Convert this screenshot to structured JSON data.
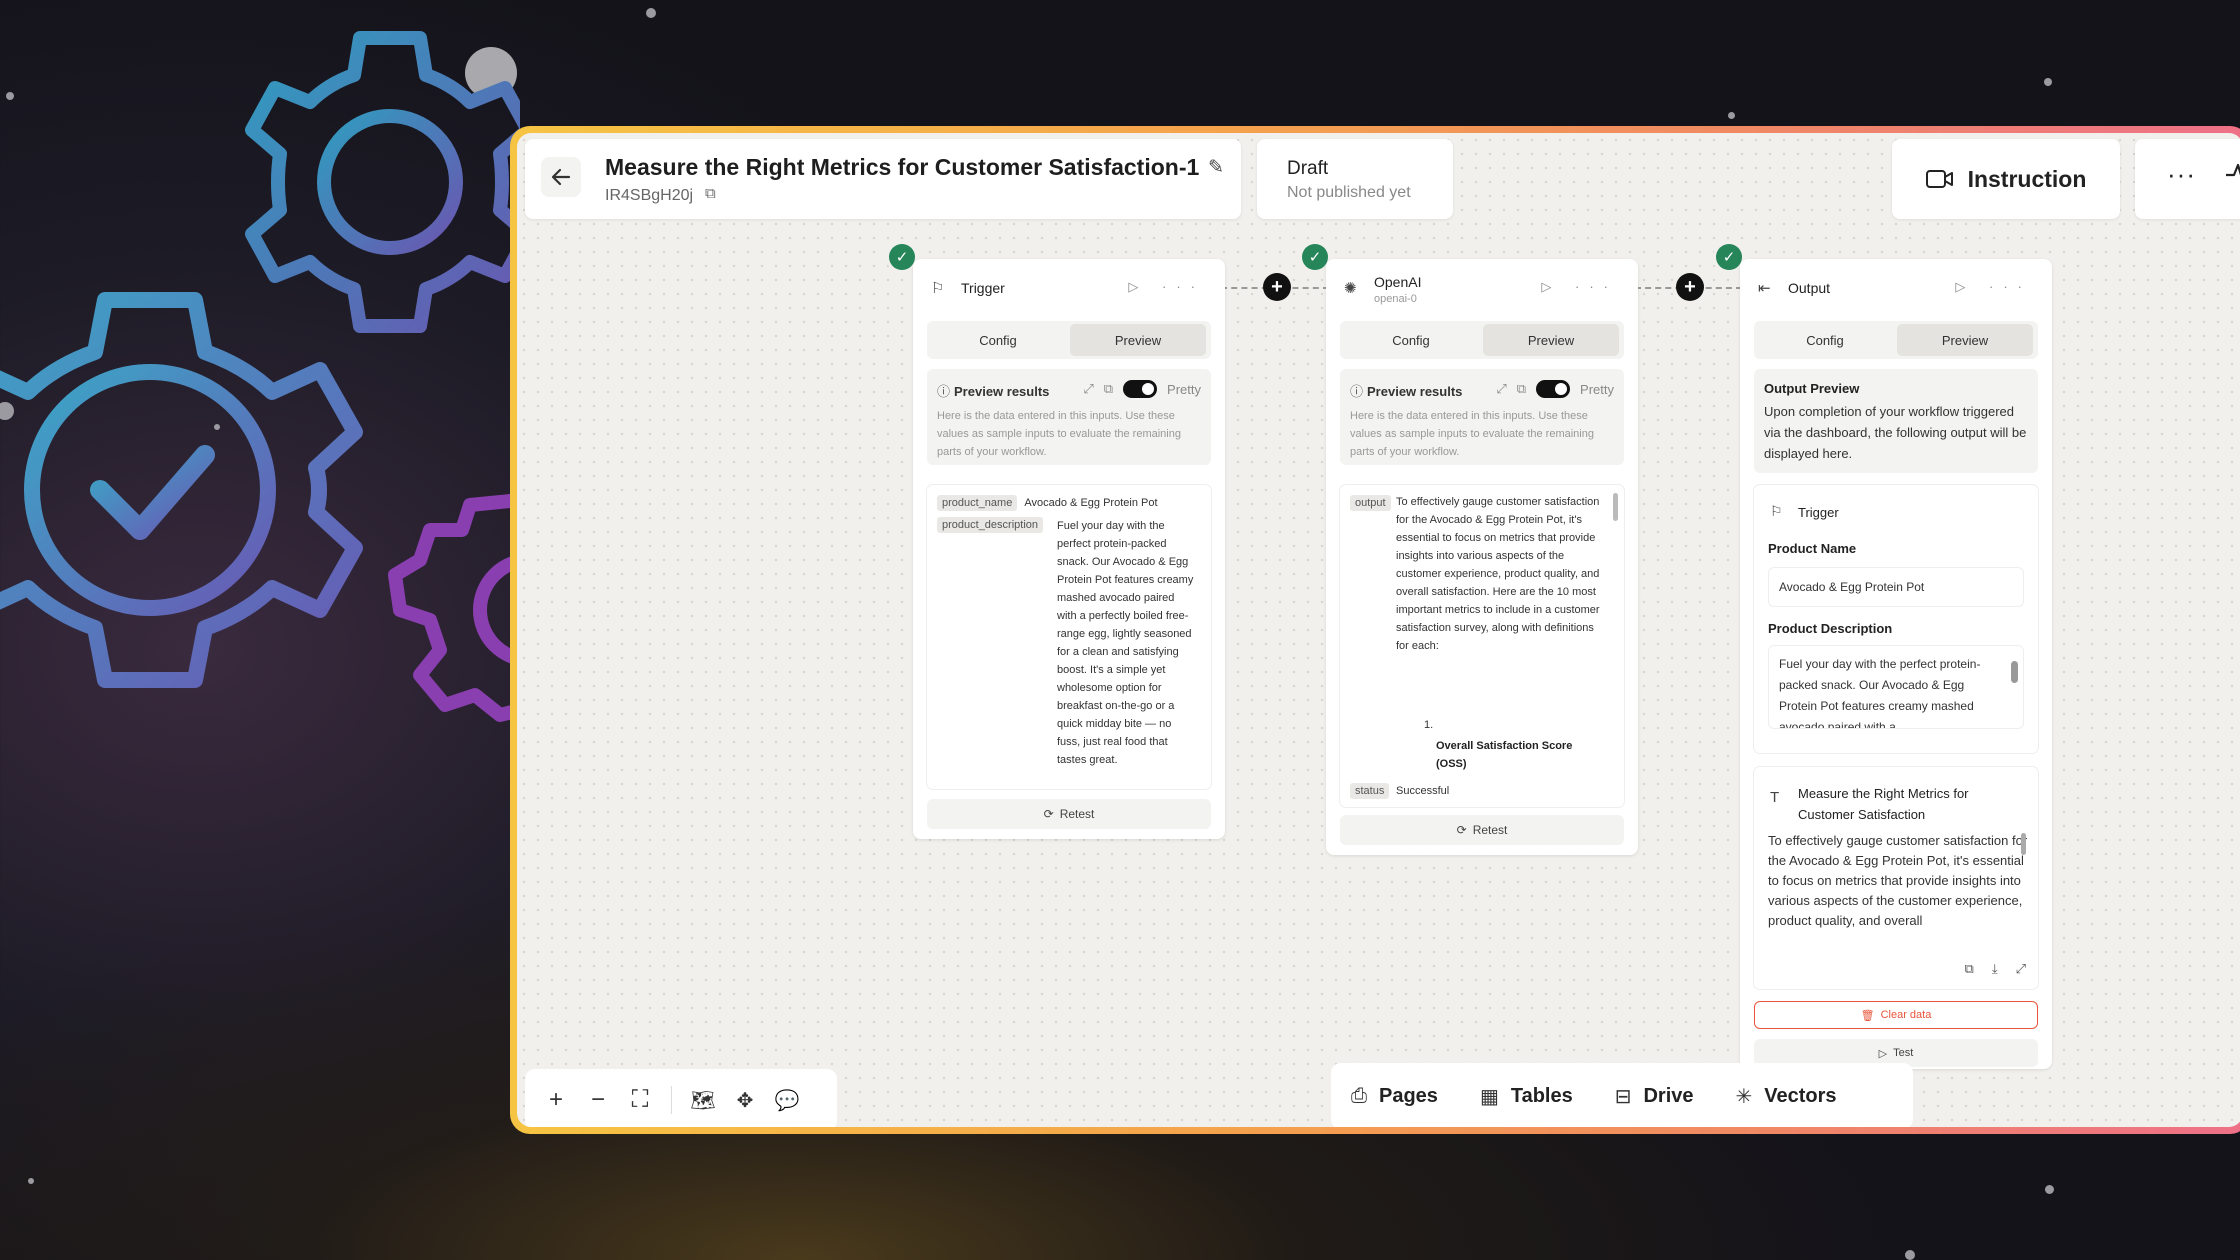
{
  "header": {
    "back_icon": "arrow-left-icon",
    "title": "Measure the Right Metrics for Customer Satisfaction-1",
    "workflow_id": "IR4SBgH20j",
    "status": "Draft",
    "status_sub": "Not published yet",
    "instruction_label": "Instruction"
  },
  "nodes": {
    "trigger": {
      "name": "Trigger",
      "tab_config": "Config",
      "tab_preview": "Preview",
      "preview_title": "Preview results",
      "pretty": "Pretty",
      "preview_desc": "Here is the data entered in this inputs. Use these values as sample inputs to evaluate the remaining parts of your workflow.",
      "key1": "product_name",
      "val1": "Avocado & Egg Protein Pot",
      "key2": "product_description",
      "val2": "Fuel your day with the perfect protein-packed snack. Our Avocado & Egg Protein Pot features creamy mashed avocado paired with a perfectly boiled free-range egg, lightly seasoned for a clean and satisfying boost. It's a simple yet wholesome option for breakfast on-the-go or a quick midday bite — no fuss, just real food that tastes great.",
      "retest": "Retest"
    },
    "openai": {
      "name": "OpenAI",
      "sub": "openai-0",
      "tab_config": "Config",
      "tab_preview": "Preview",
      "preview_title": "Preview results",
      "pretty": "Pretty",
      "preview_desc": "Here is the data entered in this inputs. Use these values as sample inputs to evaluate the remaining parts of your workflow.",
      "key_output": "output",
      "output_text": "To effectively gauge customer satisfaction for the Avocado & Egg Protein Pot, it's essential to focus on metrics that provide insights into various aspects of the customer experience, product quality, and overall satisfaction. Here are the 10 most important metrics to include in a customer satisfaction survey, along with definitions for each:",
      "list_num": "1.",
      "list_item": "Overall Satisfaction Score (OSS)",
      "key_status": "status",
      "status_val": "Successful",
      "retest": "Retest"
    },
    "output": {
      "name": "Output",
      "tab_config": "Config",
      "tab_preview": "Preview",
      "op_title": "Output Preview",
      "op_desc": "Upon completion of your workflow triggered via the dashboard, the following output will be displayed here.",
      "trigger_label": "Trigger",
      "product_name_label": "Product Name",
      "product_name_val": "Avocado & Egg Protein Pot",
      "product_desc_label": "Product Description",
      "product_desc_val": "Fuel your day with the perfect protein-packed snack. Our Avocado & Egg Protein Pot features creamy mashed avocado paired with a",
      "doc_title": "Measure the Right Metrics for Customer Satisfaction",
      "doc_text": "To effectively gauge customer satisfaction for the Avocado & Egg Protein Pot, it's essential to focus on metrics that provide insights into various aspects of the customer experience, product quality, and overall",
      "clear_label": "Clear data",
      "test_label": "Test"
    }
  },
  "bottom_bar": {
    "pages": "Pages",
    "tables": "Tables",
    "drive": "Drive",
    "vectors": "Vectors"
  },
  "colors": {
    "success": "#27855a",
    "clear": "#e8553b",
    "frame_start": "#f6c443",
    "frame_end": "#ee7088"
  }
}
